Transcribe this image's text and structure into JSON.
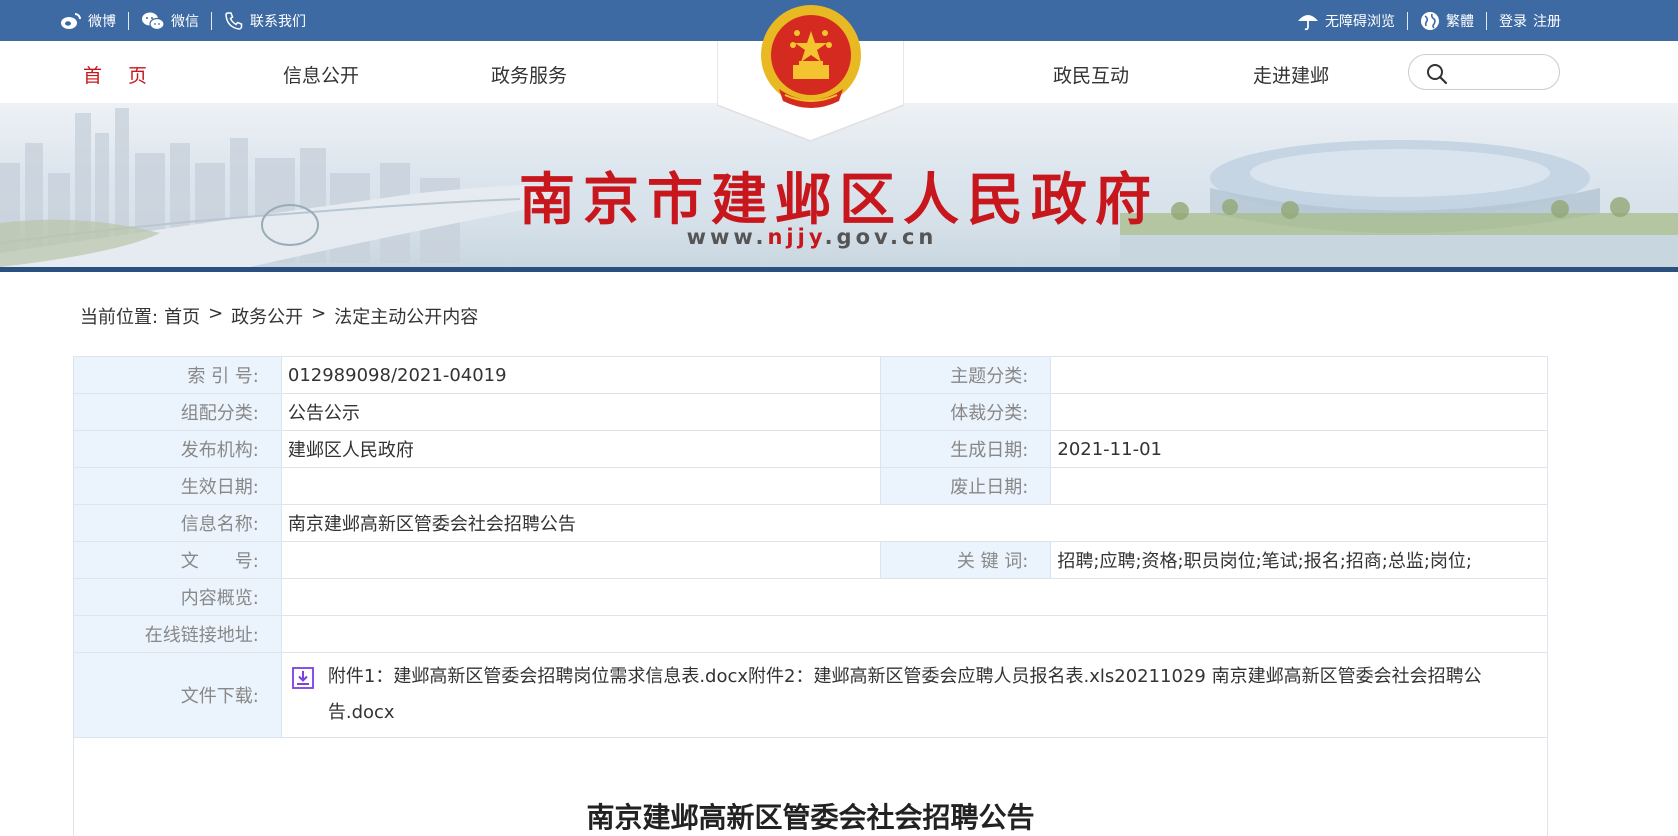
{
  "topbar": {
    "weibo": "微博",
    "wechat": "微信",
    "contact": "联系我们",
    "accessibility": "无障碍浏览",
    "traditional": "繁體",
    "login": "登录",
    "register": "注册"
  },
  "nav": {
    "home": "首页",
    "info_open": "信息公开",
    "gov_service": "政务服务",
    "interaction": "政民互动",
    "about": "走进建邺",
    "search_placeholder": ""
  },
  "banner": {
    "title": "南京市建邺区人民政府",
    "url_prefix": "www.",
    "url_highlight": "njjy",
    "url_suffix": ".gov.cn"
  },
  "breadcrumb": {
    "prefix": "当前位置:",
    "items": [
      "首页",
      "政务公开",
      "法定主动公开内容"
    ],
    "separator": ">"
  },
  "meta": {
    "index_label": "索 引 号:",
    "index_value": "012989098/2021-04019",
    "topic_label": "主题分类:",
    "topic_value": "",
    "group_label": "组配分类:",
    "group_value": "公告公示",
    "genre_label": "体裁分类:",
    "genre_value": "",
    "publisher_label": "发布机构:",
    "publisher_value": "建邺区人民政府",
    "created_label": "生成日期:",
    "created_value": "2021-11-01",
    "effective_label": "生效日期:",
    "effective_value": "",
    "abolish_label": "废止日期:",
    "abolish_value": "",
    "name_label": "信息名称:",
    "name_value": "南京建邺高新区管委会社会招聘公告",
    "docno_label": "文　　号:",
    "docno_value": "",
    "keywords_label": "关 键 词:",
    "keywords_value": "招聘;应聘;资格;职员岗位;笔试;报名;招商;总监;岗位;",
    "summary_label": "内容概览:",
    "summary_value": "",
    "link_label": "在线链接地址:",
    "link_value": "",
    "download_label": "文件下载:",
    "download_value": "附件1：建邺高新区管委会招聘岗位需求信息表.docx附件2：建邺高新区管委会应聘人员报名表.xls20211029 南京建邺高新区管委会社会招聘公告.docx"
  },
  "content": {
    "title": "南京建邺高新区管委会社会招聘公告"
  },
  "colors": {
    "topbar": "#3e6aa4",
    "accent_red": "#c8161d",
    "label_bg": "#ebf3fc"
  }
}
